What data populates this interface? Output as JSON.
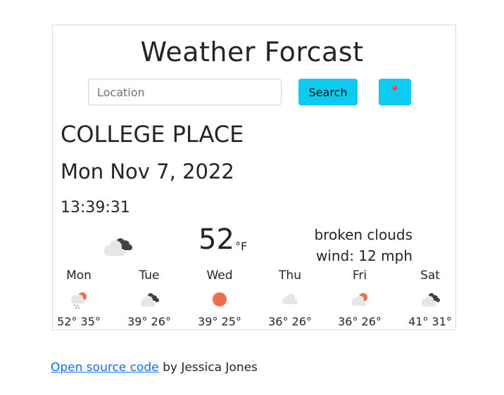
{
  "app": {
    "title": "Weather Forcast",
    "search_placeholder": "Location",
    "search_label": "Search",
    "location_button_glyph": "📍"
  },
  "current": {
    "city": "COLLEGE PLACE",
    "date": "Mon Nov 7, 2022",
    "time": "13:39:31",
    "temperature": "52",
    "unit": "°F",
    "description": "broken clouds",
    "wind": "wind: 12 mph",
    "icon": "broken-clouds-icon"
  },
  "forecast": [
    {
      "day": "Mon",
      "temps": "52° 35°",
      "icon": "rain-sun-icon"
    },
    {
      "day": "Tue",
      "temps": "39° 26°",
      "icon": "broken-clouds-icon"
    },
    {
      "day": "Wed",
      "temps": "39° 25°",
      "icon": "sun-icon"
    },
    {
      "day": "Thu",
      "temps": "36° 26°",
      "icon": "cloud-icon"
    },
    {
      "day": "Fri",
      "temps": "36° 26°",
      "icon": "partly-sunny-icon"
    },
    {
      "day": "Sat",
      "temps": "41° 31°",
      "icon": "broken-clouds-icon"
    }
  ],
  "footer": {
    "link_text": "Open source code",
    "byline": " by Jessica Jones"
  },
  "colors": {
    "button": "#0dcaf0",
    "link": "#0d6efd",
    "sun": "#ec6e4c",
    "dark_cloud": "#424242",
    "light_cloud": "#e6e6e6"
  }
}
